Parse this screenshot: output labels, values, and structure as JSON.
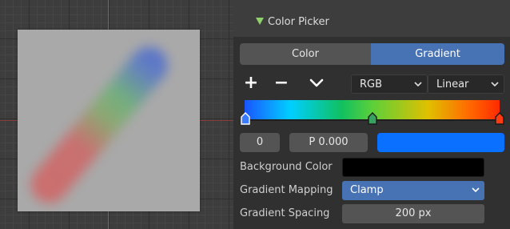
{
  "panel": {
    "title": "Color Picker",
    "mode_tabs": [
      "Color",
      "Gradient"
    ],
    "active_mode": "Gradient",
    "gradient_ops": [
      "+",
      "−"
    ],
    "color_mode": "RGB",
    "interpolation": "Linear",
    "stop_index": "0",
    "stop_position": "P  0.000",
    "stop_color": "#0a70ff",
    "background_color_label": "Background Color",
    "background_color": "#000000",
    "gradient_mapping_label": "Gradient Mapping",
    "gradient_mapping": "Clamp",
    "gradient_spacing_label": "Gradient Spacing",
    "gradient_spacing": "200 px"
  },
  "colors": {
    "accent": "#4772b3",
    "header_arrow": "#8fd16b"
  }
}
